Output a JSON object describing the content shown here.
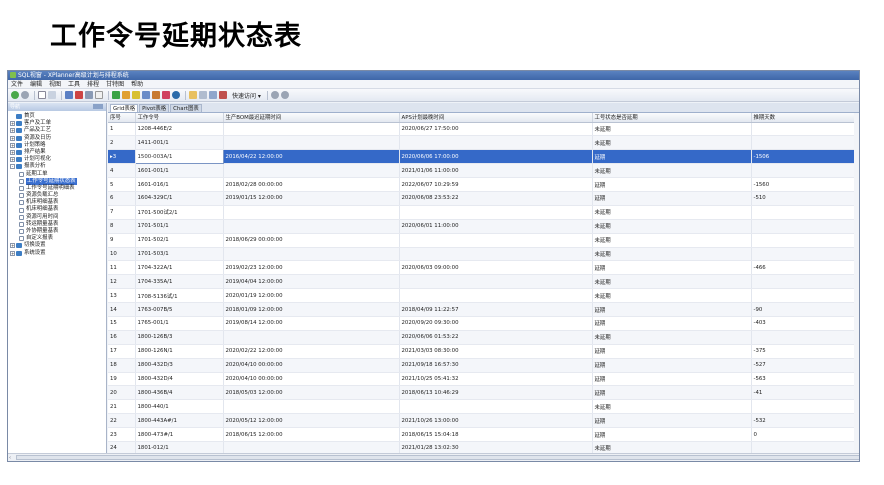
{
  "slide_title": "工作令号延期状态表",
  "window": {
    "title": "SQL视窗 - XPlanner高级计划与排程系统"
  },
  "menu": [
    "文件",
    "编辑",
    "视图",
    "工具",
    "排程",
    "甘特图",
    "帮助"
  ],
  "toolbar": {
    "quick_access_label": "快速访问 ▾"
  },
  "sidebar": {
    "header": "导航",
    "items": [
      {
        "label": "首页",
        "level": 0,
        "exp": "",
        "type": "folder"
      },
      {
        "label": "客户及工单",
        "level": 0,
        "exp": "+",
        "type": "folder"
      },
      {
        "label": "产品及工艺",
        "level": 0,
        "exp": "+",
        "type": "folder"
      },
      {
        "label": "资源及日历",
        "level": 0,
        "exp": "+",
        "type": "folder"
      },
      {
        "label": "计划策略",
        "level": 0,
        "exp": "+",
        "type": "folder"
      },
      {
        "label": "排产结果",
        "level": 0,
        "exp": "+",
        "type": "folder"
      },
      {
        "label": "计划可视化",
        "level": 0,
        "exp": "+",
        "type": "folder"
      },
      {
        "label": "报表分析",
        "level": 0,
        "exp": "-",
        "type": "folder"
      },
      {
        "label": "延期工单",
        "level": 1,
        "exp": "",
        "type": "doc"
      },
      {
        "label": "工作令号延期状态表",
        "level": 1,
        "exp": "",
        "type": "doc",
        "selected": true
      },
      {
        "label": "工作令号延期明细表",
        "level": 1,
        "exp": "",
        "type": "doc"
      },
      {
        "label": "资源负载汇总",
        "level": 1,
        "exp": "",
        "type": "doc"
      },
      {
        "label": "机床明细基表",
        "level": 1,
        "exp": "",
        "type": "doc"
      },
      {
        "label": "机床明细基表",
        "level": 1,
        "exp": "",
        "type": "doc"
      },
      {
        "label": "资源可用时间",
        "level": 1,
        "exp": "",
        "type": "doc"
      },
      {
        "label": "转运期量基表",
        "level": 1,
        "exp": "",
        "type": "doc"
      },
      {
        "label": "外协期量基表",
        "level": 1,
        "exp": "",
        "type": "doc"
      },
      {
        "label": "自定义报表",
        "level": 1,
        "exp": "",
        "type": "doc"
      },
      {
        "label": "切换设置",
        "level": 0,
        "exp": "+",
        "type": "folder"
      },
      {
        "label": "系统设置",
        "level": 0,
        "exp": "+",
        "type": "folder"
      }
    ]
  },
  "tabs": [
    {
      "label": "Grid表格",
      "active": true
    },
    {
      "label": "Pivot表格",
      "active": false
    },
    {
      "label": "Chart图表",
      "active": false
    }
  ],
  "grid": {
    "columns": [
      "序号",
      "工作令号",
      "生产BOM最迟延期时间",
      "APS计划最晚时间",
      "工号状态是否延期",
      "推期天数"
    ],
    "rows": [
      [
        "1",
        "1208-446E/2",
        "",
        "2020/06/27 17:50:00",
        "未延期",
        ""
      ],
      [
        "2",
        "1411-001/1",
        "",
        "",
        "未延期",
        ""
      ],
      [
        "3",
        "1500-003A/1",
        "2016/04/22 12:00:00",
        "2020/06/06 17:00:00",
        "延期",
        "-1506"
      ],
      [
        "4",
        "1601-001/1",
        "",
        "2021/01/06 11:00:00",
        "未延期",
        ""
      ],
      [
        "5",
        "1601-016/1",
        "2018/02/28 00:00:00",
        "2022/06/07 10:29:59",
        "延期",
        "-1560"
      ],
      [
        "6",
        "1604-329C/1",
        "2019/01/15 12:00:00",
        "2020/06/08 23:53:22",
        "延期",
        "-510"
      ],
      [
        "7",
        "1701-500试2/1",
        "",
        "",
        "未延期",
        ""
      ],
      [
        "8",
        "1701-501/1",
        "",
        "2020/06/01 11:00:00",
        "未延期",
        ""
      ],
      [
        "9",
        "1701-502/1",
        "2018/06/29 00:00:00",
        "",
        "未延期",
        ""
      ],
      [
        "10",
        "1701-503/1",
        "",
        "",
        "未延期",
        ""
      ],
      [
        "11",
        "1704-322A/1",
        "2019/02/23 12:00:00",
        "2020/06/03 09:00:00",
        "延期",
        "-466"
      ],
      [
        "12",
        "1704-335A/1",
        "2019/04/04 12:00:00",
        "",
        "未延期",
        ""
      ],
      [
        "13",
        "1708-5136试/1",
        "2020/01/19 12:00:00",
        "",
        "未延期",
        ""
      ],
      [
        "14",
        "1763-007B/5",
        "2018/01/09 12:00:00",
        "2018/04/09 11:22:57",
        "延期",
        "-90"
      ],
      [
        "15",
        "1765-001/1",
        "2019/08/14 12:00:00",
        "2020/09/20 09:30:00",
        "延期",
        "-403"
      ],
      [
        "16",
        "1800-126B/3",
        "",
        "2020/06/06 01:53:22",
        "未延期",
        ""
      ],
      [
        "17",
        "1800-126N/1",
        "2020/02/22 12:00:00",
        "2021/03/03 08:30:00",
        "延期",
        "-375"
      ],
      [
        "18",
        "1800-432D/3",
        "2020/04/10 00:00:00",
        "2021/09/18 16:57:30",
        "延期",
        "-527"
      ],
      [
        "19",
        "1800-432D/4",
        "2020/04/10 00:00:00",
        "2021/10/25 05:41:32",
        "延期",
        "-563"
      ],
      [
        "20",
        "1800-436B/4",
        "2018/05/03 12:00:00",
        "2018/06/13 10:46:29",
        "延期",
        "-41"
      ],
      [
        "21",
        "1800-440/1",
        "",
        "",
        "未延期",
        ""
      ],
      [
        "22",
        "1800-443A#/1",
        "2020/05/12 12:00:00",
        "2021/10/26 13:00:00",
        "延期",
        "-532"
      ],
      [
        "23",
        "1800-473#/1",
        "2018/06/15 12:00:00",
        "2018/06/15 15:04:18",
        "延期",
        "0"
      ],
      [
        "24",
        "1801-012/1",
        "",
        "2021/01/28 13:02:30",
        "未延期",
        ""
      ]
    ],
    "selected_row": 2,
    "row_marker": "▸"
  },
  "colors": {
    "selection": "#3569c8",
    "titlebar": "#4a72b4",
    "tree_folder": "#3c7dc4"
  }
}
